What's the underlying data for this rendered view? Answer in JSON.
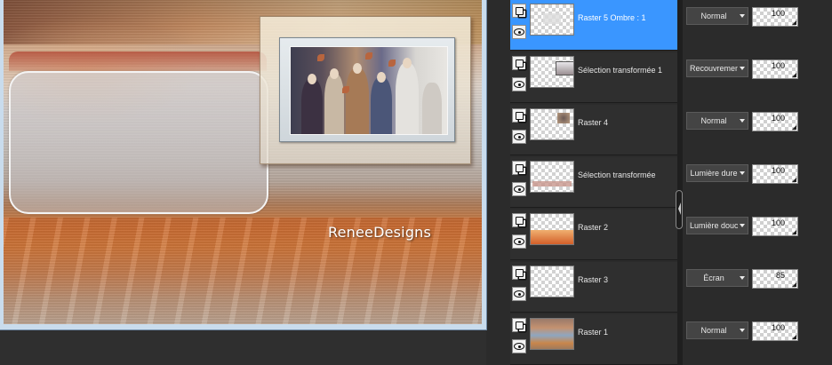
{
  "canvas": {
    "watermark": "ReneeDesigns"
  },
  "layers": [
    {
      "name": "Raster 5 Ombre : 1",
      "blend": "Normal",
      "opacity": "100",
      "selected": true
    },
    {
      "name": "Sélection transformée 1",
      "blend": "Recouvrement",
      "opacity": "100",
      "selected": false
    },
    {
      "name": "Raster 4",
      "blend": "Normal",
      "opacity": "100",
      "selected": false
    },
    {
      "name": "Sélection transformée",
      "blend": "Lumière dure",
      "opacity": "100",
      "selected": false
    },
    {
      "name": "Raster 2",
      "blend": "Lumière douce",
      "opacity": "100",
      "selected": false
    },
    {
      "name": "Raster 3",
      "blend": "Écran",
      "opacity": "85",
      "selected": false
    },
    {
      "name": "Raster 1",
      "blend": "Normal",
      "opacity": "100",
      "selected": false
    }
  ],
  "icons": {
    "link": "layer-link-icon",
    "visibility": "eye-icon",
    "dropdown": "chevron-down-icon"
  },
  "colors": {
    "selected_row": "#3a96ff",
    "panel_bg": "#2b2b2b"
  }
}
